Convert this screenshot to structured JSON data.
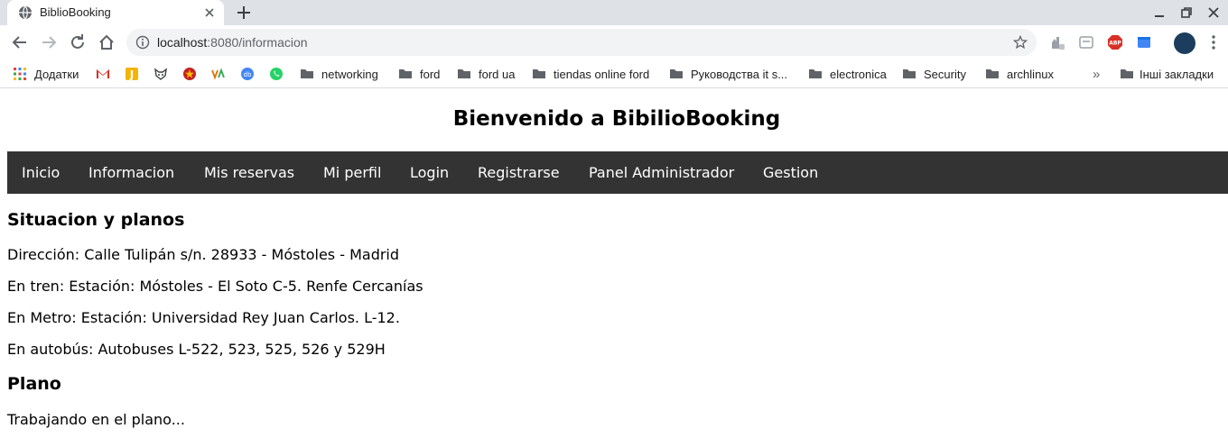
{
  "browser": {
    "tab": {
      "title": "BiblioBooking"
    },
    "address": {
      "host": "localhost",
      "rest": ":8080/informacion"
    },
    "bookmarks": {
      "apps_label": "Додатки",
      "items": [
        {
          "label": "networking"
        },
        {
          "label": "ford"
        },
        {
          "label": "ford ua"
        },
        {
          "label": "tiendas online ford"
        },
        {
          "label": "Руководства it s..."
        },
        {
          "label": "electronica"
        },
        {
          "label": "Security"
        },
        {
          "label": "archlinux"
        }
      ],
      "overflow": "»",
      "other_label": "Інші закладки"
    },
    "extensions": {
      "abp_label": "ABP"
    }
  },
  "page": {
    "title": "Bienvenido a BibilioBooking",
    "nav": [
      {
        "label": "Inicio"
      },
      {
        "label": "Informacion"
      },
      {
        "label": "Mis reservas"
      },
      {
        "label": "Mi perfil"
      },
      {
        "label": "Login"
      },
      {
        "label": "Registrarse"
      },
      {
        "label": "Panel Administrador"
      },
      {
        "label": "Gestion"
      }
    ],
    "section1": {
      "heading": "Situacion y planos",
      "lines": [
        "Dirección: Calle Tulipán s/n. 28933 - Móstoles - Madrid",
        "En tren: Estación: Móstoles - El Soto C-5. Renfe Cercanías",
        "En Metro: Estación: Universidad Rey Juan Carlos. L-12.",
        "En autobús: Autobuses L-522, 523, 525, 526 y 529H"
      ]
    },
    "section2": {
      "heading": "Plano",
      "lines": [
        "Trabajando en el plano..."
      ]
    }
  },
  "colors": {
    "nav_background": "#333333",
    "nav_text": "#ffffff",
    "tabstrip": "#dee1e6",
    "omnibox": "#f1f3f4"
  }
}
